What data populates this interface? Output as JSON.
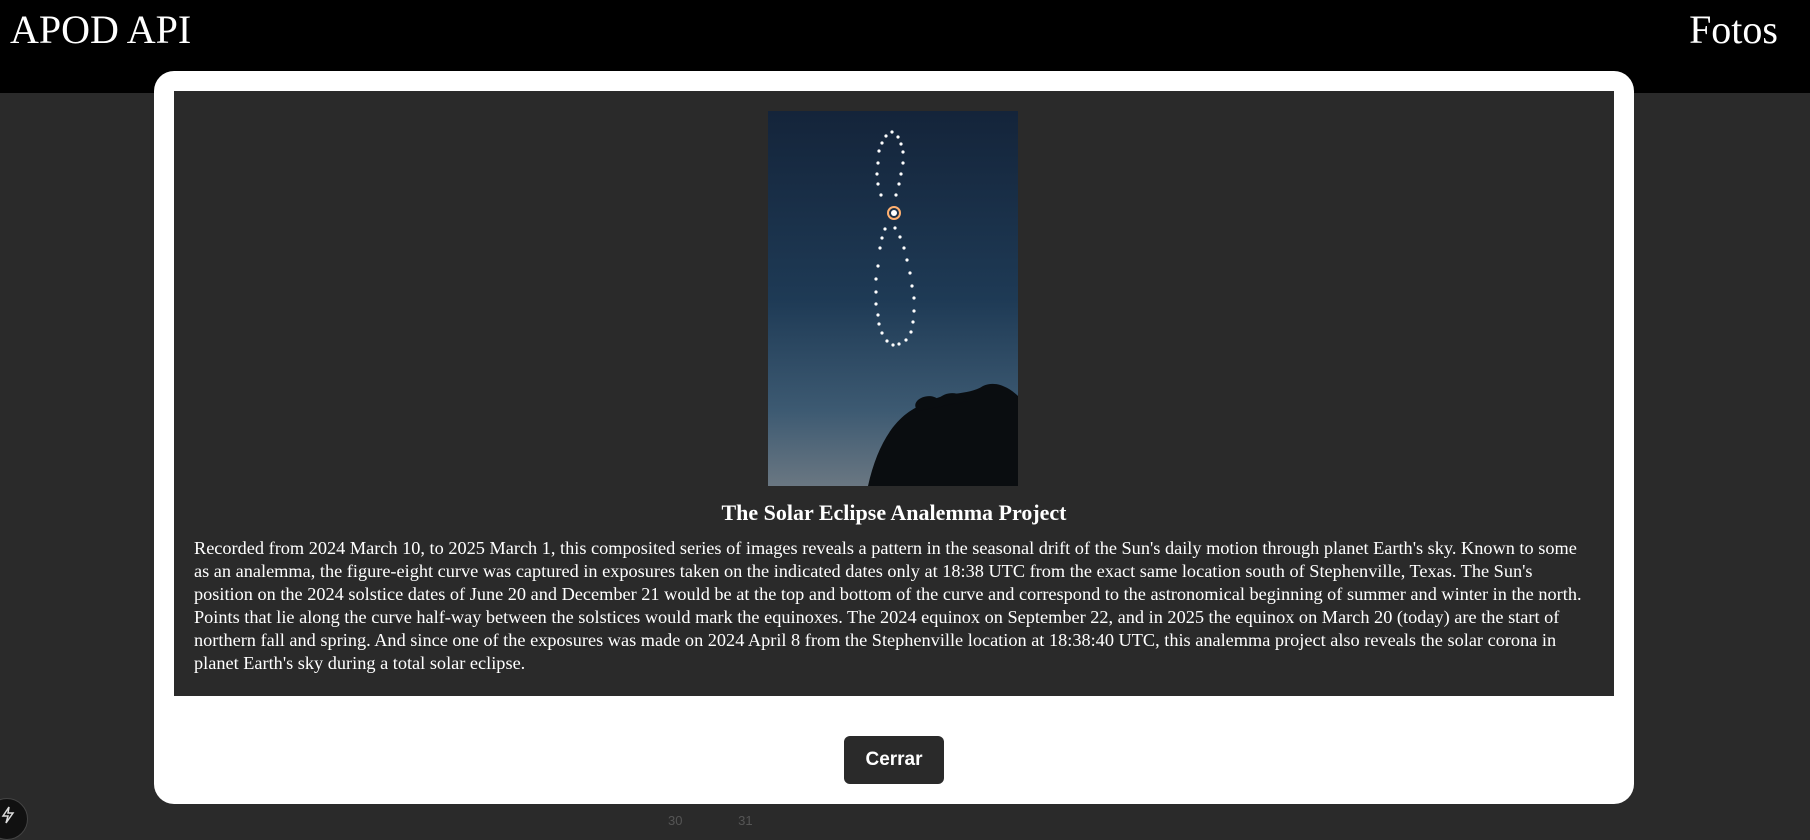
{
  "header": {
    "brand": "APOD API",
    "nav_fotos": "Fotos"
  },
  "background": {
    "numbers": [
      "30",
      "31"
    ]
  },
  "modal": {
    "image_alt": "The Solar Eclipse Analemma Project",
    "title": "The Solar Eclipse Analemma Project",
    "description": "Recorded from 2024 March 10, to 2025 March 1, this composited series of images reveals a pattern in the seasonal drift of the Sun's daily motion through planet Earth's sky. Known to some as an analemma, the figure-eight curve was captured in exposures taken on the indicated dates only at 18:38 UTC from the exact same location south of Stephenville, Texas. The Sun's position on the 2024 solstice dates of June 20 and December 21 would be at the top and bottom of the curve and correspond to the astronomical beginning of summer and winter in the north. Points that lie along the curve half-way between the solstices would mark the equinoxes. The 2024 equinox on September 22, and in 2025 the equinox on March 20 (today) are the start of northern fall and spring. And since one of the exposures was made on 2024 April 8 from the Stephenville location at 18:38:40 UTC, this analemma project also reveals the solar corona in planet Earth's sky during a total solar eclipse.",
    "close_label": "Cerrar"
  },
  "icons": {
    "corner_badge": "bolt-icon"
  },
  "colors": {
    "header_bg": "#000000",
    "page_bg": "#2a2a2a",
    "modal_bg": "#ffffff",
    "button_bg": "#2a2a2a"
  }
}
